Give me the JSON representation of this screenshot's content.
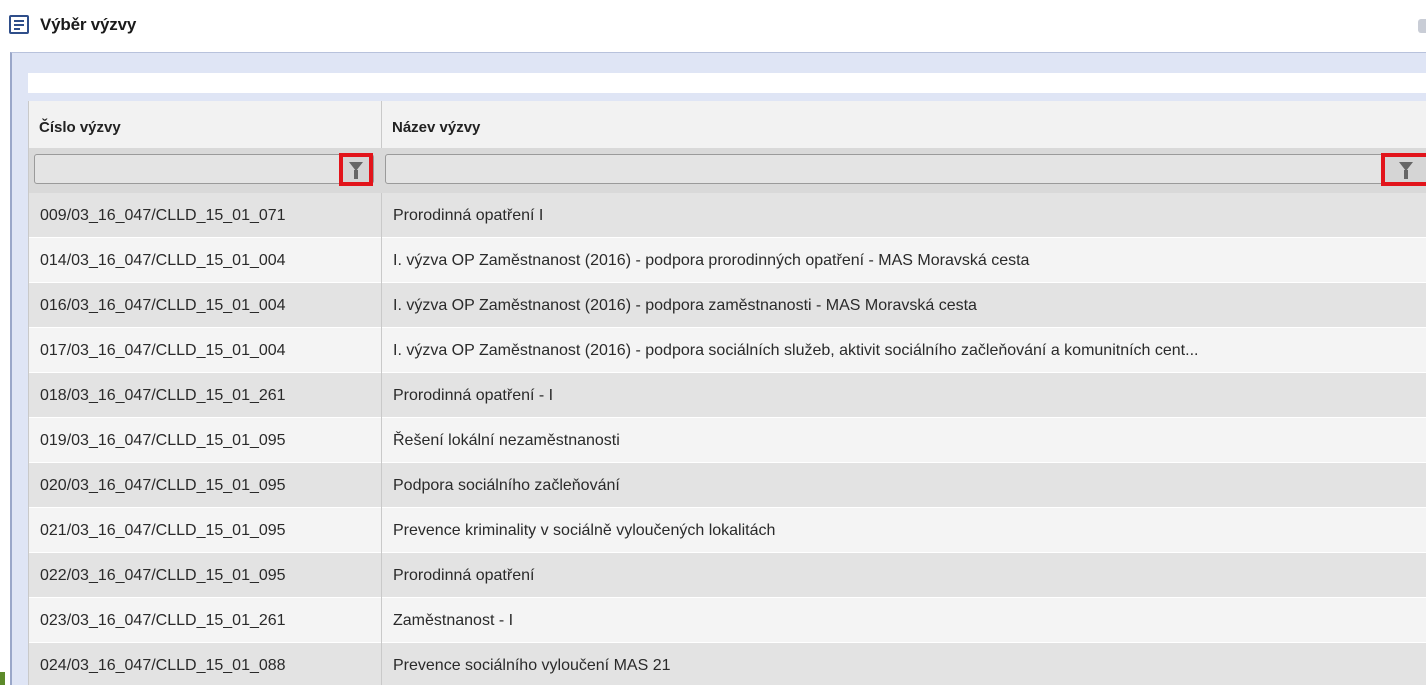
{
  "window": {
    "title": "Výběr výzvy"
  },
  "grid": {
    "columns": [
      {
        "label": "Číslo výzvy"
      },
      {
        "label": "Název výzvy"
      }
    ],
    "filters": [
      {
        "value": "",
        "placeholder": ""
      },
      {
        "value": "",
        "placeholder": ""
      }
    ],
    "rows": [
      {
        "cislo": "009/03_16_047/CLLD_15_01_071",
        "nazev": "Prorodinná opatření I"
      },
      {
        "cislo": "014/03_16_047/CLLD_15_01_004",
        "nazev": "I. výzva OP Zaměstnanost (2016) - podpora prorodinných opatření - MAS Moravská cesta"
      },
      {
        "cislo": "016/03_16_047/CLLD_15_01_004",
        "nazev": "I. výzva OP Zaměstnanost (2016) - podpora zaměstnanosti - MAS Moravská cesta"
      },
      {
        "cislo": "017/03_16_047/CLLD_15_01_004",
        "nazev": "I. výzva OP Zaměstnanost (2016) - podpora sociálních služeb, aktivit sociálního začleňování a komunitních cent..."
      },
      {
        "cislo": "018/03_16_047/CLLD_15_01_261",
        "nazev": "Prorodinná opatření - I"
      },
      {
        "cislo": "019/03_16_047/CLLD_15_01_095",
        "nazev": "Řešení lokální nezaměstnanosti"
      },
      {
        "cislo": "020/03_16_047/CLLD_15_01_095",
        "nazev": "Podpora sociálního začleňování"
      },
      {
        "cislo": "021/03_16_047/CLLD_15_01_095",
        "nazev": "Prevence kriminality v sociálně vyloučených lokalitách"
      },
      {
        "cislo": "022/03_16_047/CLLD_15_01_095",
        "nazev": "Prorodinná opatření"
      },
      {
        "cislo": "023/03_16_047/CLLD_15_01_261",
        "nazev": "Zaměstnanost - I"
      },
      {
        "cislo": "024/03_16_047/CLLD_15_01_088",
        "nazev": "Prevence sociálního vyloučení MAS 21"
      }
    ]
  },
  "icons": {
    "title": "list-window-icon",
    "filter": "funnel-icon",
    "close": "close-icon"
  },
  "colors": {
    "highlight": "#e2141b",
    "frame": "#dfe5f5"
  }
}
